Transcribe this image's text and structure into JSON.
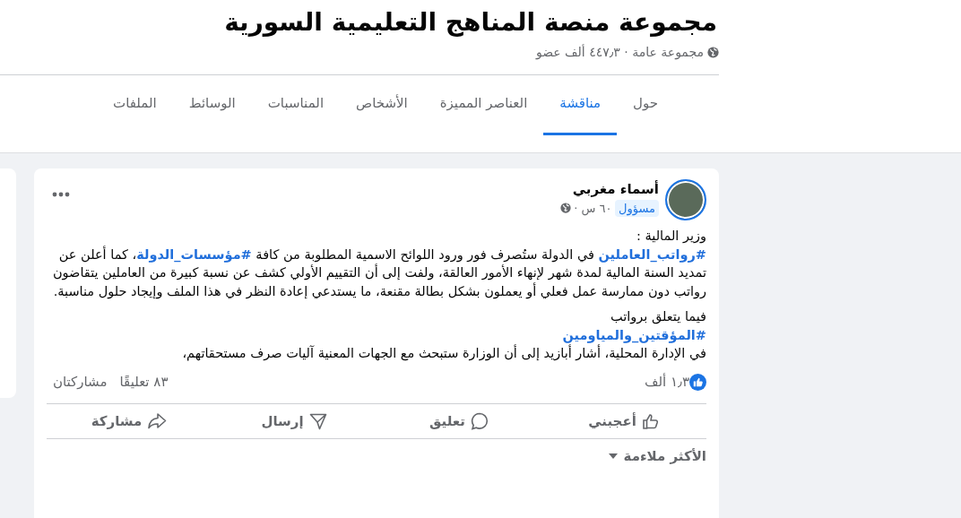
{
  "group": {
    "title": "مجموعة منصة المناهج التعليمية السورية",
    "meta": "مجموعة عامة · ٤٤٧٫٣ ألف عضو"
  },
  "tabs": [
    {
      "label": "حول",
      "selected": false
    },
    {
      "label": "مناقشة",
      "selected": true
    },
    {
      "label": "العناصر المميزة",
      "selected": false
    },
    {
      "label": "الأشخاص",
      "selected": false
    },
    {
      "label": "المناسبات",
      "selected": false
    },
    {
      "label": "الوسائط",
      "selected": false
    },
    {
      "label": "الملفات",
      "selected": false
    }
  ],
  "post": {
    "author": "أسماء مغربي",
    "badge": "مسؤول",
    "time": "٦٠ س ·",
    "paragraphs": [
      [
        {
          "kind": "text",
          "text": "وزير المالية :"
        }
      ],
      [
        {
          "kind": "hashtag",
          "text": "#رواتب_العاملين"
        },
        {
          "kind": "text",
          "text": " في الدولة ستُصرف فور ورود اللوائح الاسمية المطلوبة من كافة "
        },
        {
          "kind": "hashtag",
          "text": "#مؤسسات_الدولة"
        },
        {
          "kind": "text",
          "text": "، كما أعلن عن تمديد السنة المالية لمدة شهر لإنهاء الأمور العالقة، ولفت إلى أن التقييم الأولي كشف عن نسبة كبيرة من العاملين يتقاضون رواتب دون ممارسة عمل فعلي أو يعملون بشكل بطالة مقنعة، ما يستدعي إعادة النظر في هذا الملف وإيجاد حلول مناسبة."
        }
      ],
      [
        {
          "kind": "gap"
        }
      ],
      [
        {
          "kind": "text",
          "text": "فيما يتعلق برواتب"
        }
      ],
      [
        {
          "kind": "hashtag",
          "text": "#المؤقتين_والمياومين"
        }
      ],
      [
        {
          "kind": "text",
          "text": "في الإدارة المحلية، أشار أبازيد إلى أن الوزارة ستبحث مع الجهات المعنية آليات صرف مستحقاتهم،"
        }
      ]
    ],
    "reactions": "١٫٣ ألف",
    "comments": "٨٣ تعليقًا",
    "shares": "مشاركتان",
    "actions": [
      {
        "kind": "like",
        "label": "أعجبني"
      },
      {
        "kind": "comment",
        "label": "تعليق"
      },
      {
        "kind": "send",
        "label": "إرسال"
      },
      {
        "kind": "share",
        "label": "مشاركة"
      }
    ],
    "sort": "الأكثر ملاءمة"
  }
}
